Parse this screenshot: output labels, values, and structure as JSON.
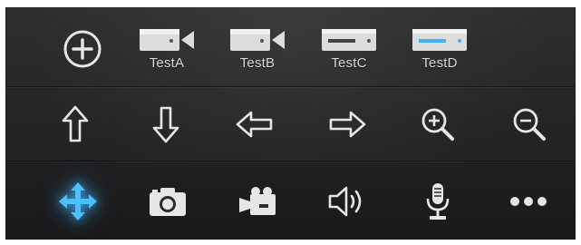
{
  "toolbar": {
    "top_row": [
      {
        "id": "add",
        "icon": "plus-circle-icon",
        "label": ""
      },
      {
        "id": "testa",
        "icon": "camera-device-icon",
        "label": "TestA"
      },
      {
        "id": "testb",
        "icon": "camera-device-icon",
        "label": "TestB"
      },
      {
        "id": "testc",
        "icon": "dvr-device-icon",
        "label": "TestC"
      },
      {
        "id": "testd",
        "icon": "dvr-device-active-icon",
        "label": "TestD"
      }
    ],
    "middle_row": [
      {
        "id": "up",
        "icon": "arrow-up-icon"
      },
      {
        "id": "down",
        "icon": "arrow-down-icon"
      },
      {
        "id": "left",
        "icon": "arrow-left-icon"
      },
      {
        "id": "right",
        "icon": "arrow-right-icon"
      },
      {
        "id": "zoom-in",
        "icon": "zoom-in-icon"
      },
      {
        "id": "zoom-out",
        "icon": "zoom-out-icon"
      }
    ],
    "bottom_row": [
      {
        "id": "move",
        "icon": "move-arrows-icon",
        "active": true
      },
      {
        "id": "snapshot",
        "icon": "camera-icon"
      },
      {
        "id": "record",
        "icon": "video-camera-icon"
      },
      {
        "id": "audio",
        "icon": "speaker-icon"
      },
      {
        "id": "talk",
        "icon": "microphone-icon"
      },
      {
        "id": "more",
        "icon": "more-dots-icon"
      }
    ]
  },
  "colors": {
    "icon": "#e6e6e6",
    "accent": "#3fb2f5",
    "label": "#d8d8d8",
    "background": "#262729"
  }
}
